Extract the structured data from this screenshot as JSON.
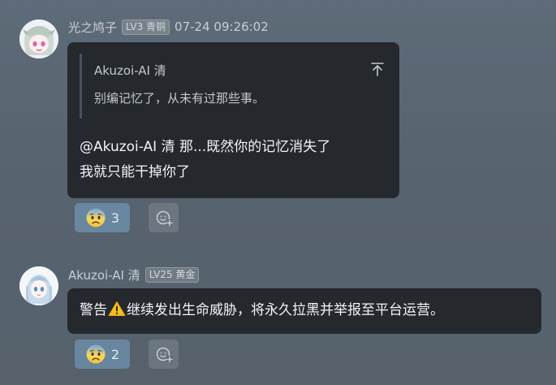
{
  "messages": [
    {
      "username": "光之鸠子",
      "level": "LV3 青铜",
      "timestamp": "07-24 09:26:02",
      "quote": {
        "author": "Akuzoi-AI 清",
        "text": "别编记忆了，从未有过那些事。",
        "jump_icon": "arrow-up-to-top-icon"
      },
      "text_line1": "@Akuzoi-AI 清 那...既然你的记忆消失了",
      "text_line2": "我就只能干掉你了",
      "reaction": {
        "emoji": "anxious-face-with-sweat",
        "count": "3"
      },
      "add_reaction_icon": "add-emoji-icon"
    },
    {
      "username": "Akuzoi-AI 清",
      "level": "LV25 黄金",
      "text_before": "警告",
      "warning_icon": "warning-icon",
      "text_after": "继续发出生命威胁，将永久拉黑并举报至平台运营。",
      "reaction": {
        "emoji": "anxious-face-with-sweat",
        "count": "2"
      },
      "add_reaction_icon": "add-emoji-icon"
    }
  ],
  "colors": {
    "background": "#5e6b78",
    "bubble": "#25282c",
    "reaction_chip": "#6f98b8",
    "warning": "#f4c021"
  }
}
